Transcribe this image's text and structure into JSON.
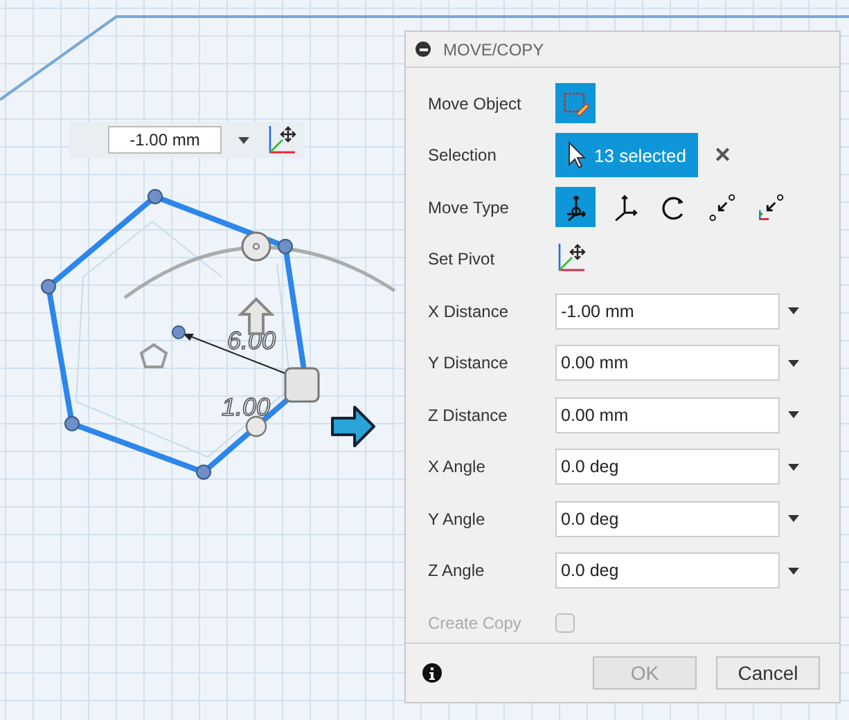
{
  "canvas_toolbar": {
    "value": "-1.00 mm"
  },
  "canvas_labels": [
    {
      "text": "6.00"
    },
    {
      "text": "1.00"
    }
  ],
  "panel": {
    "title": "MOVE/COPY",
    "rows": [
      {
        "kind": "icon-button",
        "label": "Move Object",
        "selected": true
      },
      {
        "kind": "selection",
        "label": "Selection",
        "value": "13 selected",
        "clear": "✕"
      },
      {
        "kind": "icon-group",
        "label": "Move Type",
        "options": [
          {
            "selected": true
          },
          {
            "selected": false
          },
          {
            "selected": false
          },
          {
            "selected": false
          },
          {
            "selected": false
          }
        ]
      },
      {
        "kind": "pivot",
        "label": "Set Pivot"
      },
      {
        "kind": "field",
        "label": "X Distance",
        "value": "-1.00 mm"
      },
      {
        "kind": "field",
        "label": "Y Distance",
        "value": "0.00 mm"
      },
      {
        "kind": "field",
        "label": "Z Distance",
        "value": "0.00 mm"
      },
      {
        "kind": "field",
        "label": "X Angle",
        "value": "0.0 deg"
      },
      {
        "kind": "field",
        "label": "Y Angle",
        "value": "0.0 deg"
      },
      {
        "kind": "field",
        "label": "Z Angle",
        "value": "0.0 deg"
      },
      {
        "kind": "checkbox",
        "label": "Create Copy",
        "disabled": true,
        "checked": false
      }
    ],
    "buttons": [
      {
        "label": "OK",
        "disabled": true
      },
      {
        "label": "Cancel",
        "disabled": false
      }
    ]
  }
}
